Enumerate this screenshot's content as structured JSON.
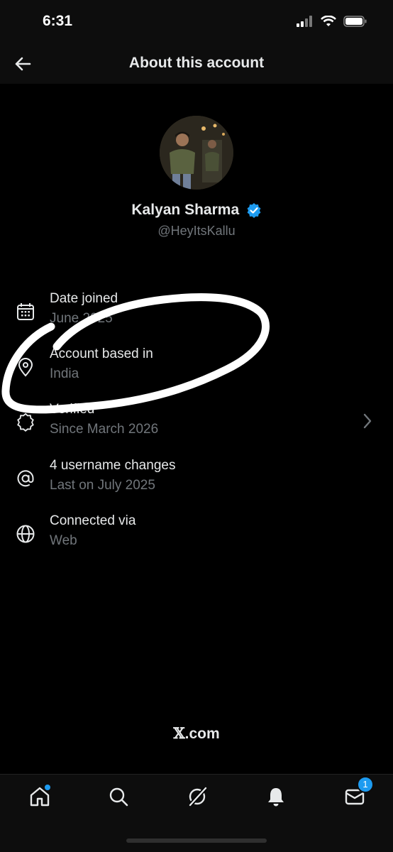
{
  "status_bar": {
    "time": "6:31"
  },
  "header": {
    "title": "About this account"
  },
  "profile": {
    "name": "Kalyan Sharma",
    "handle": "@HeyItsKallu"
  },
  "rows": [
    {
      "label": "Date joined",
      "value": "June 2025",
      "icon": "calendar-icon"
    },
    {
      "label": "Account based in",
      "value": "India",
      "icon": "location-pin-icon"
    },
    {
      "label": "Verified",
      "value": "Since March 2026",
      "icon": "verified-badge-icon"
    },
    {
      "label": "4 username changes",
      "value": "Last on July 2025",
      "icon": "at-icon"
    },
    {
      "label": "Connected via",
      "value": "Web",
      "icon": "globe-icon"
    }
  ],
  "footer": {
    "brand_x": "𝕏",
    "brand_suffix": ".com"
  },
  "tabbar": {
    "messages_badge": "1"
  },
  "colors": {
    "accent": "#1d9bf0",
    "muted_text": "#71767b",
    "primary_text": "#e7e9ea",
    "background": "#000000"
  }
}
